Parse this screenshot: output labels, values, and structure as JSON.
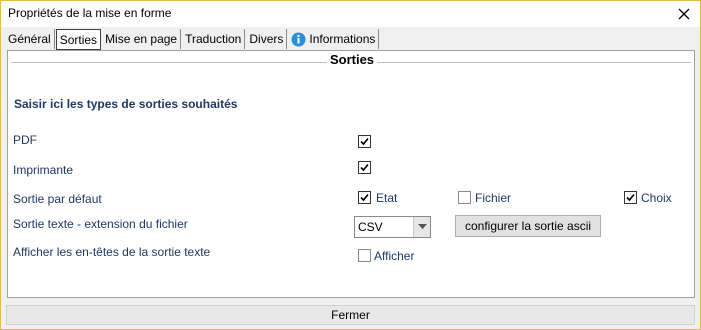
{
  "window": {
    "title": "Propriétés de la mise en forme"
  },
  "tabs": [
    {
      "label": "Général"
    },
    {
      "label": "Sorties"
    },
    {
      "label": "Mise en page"
    },
    {
      "label": "Traduction"
    },
    {
      "label": "Divers"
    },
    {
      "label": "Informations",
      "icon": "info-icon"
    }
  ],
  "active_tab": "Sorties",
  "section": {
    "title": "Sorties",
    "heading": "Saisir ici les types de sorties souhaités"
  },
  "rows": {
    "pdf": {
      "label": "PDF",
      "checked": true
    },
    "imprimante": {
      "label": "Imprimante",
      "checked": true
    },
    "defaut": {
      "label": "Sortie par défaut",
      "options": [
        {
          "label": "Etat",
          "checked": true
        },
        {
          "label": "Fichier",
          "checked": false
        },
        {
          "label": "Choix",
          "checked": true
        }
      ]
    },
    "texte": {
      "label": "Sortie texte - extension du fichier",
      "extension": "CSV",
      "configure_label": "configurer la sortie ascii"
    },
    "entetes": {
      "label": "Afficher les en-têtes de la sortie texte",
      "option_label": "Afficher",
      "checked": false
    }
  },
  "footer": {
    "close_label": "Fermer"
  },
  "colors": {
    "label_text": "#1f3864",
    "window_border": "#e8b84a",
    "info_icon": "#2b8fd6"
  }
}
